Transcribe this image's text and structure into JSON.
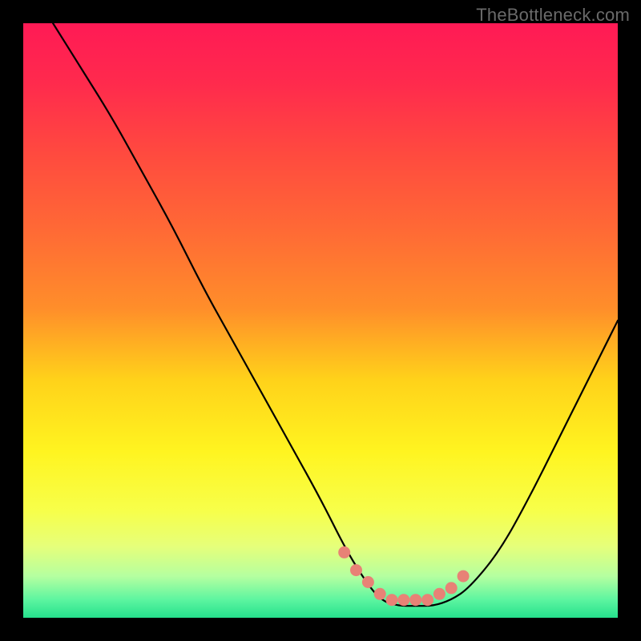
{
  "watermark": "TheBottleneck.com",
  "colors": {
    "black": "#000000",
    "line": "#000000",
    "dot": "#e88276",
    "gradient_stops": [
      {
        "offset": 0.0,
        "color": "#ff1a55"
      },
      {
        "offset": 0.1,
        "color": "#ff2a4d"
      },
      {
        "offset": 0.22,
        "color": "#ff4a3f"
      },
      {
        "offset": 0.35,
        "color": "#ff6a35"
      },
      {
        "offset": 0.48,
        "color": "#ff8e2a"
      },
      {
        "offset": 0.6,
        "color": "#ffd21a"
      },
      {
        "offset": 0.72,
        "color": "#fff420"
      },
      {
        "offset": 0.82,
        "color": "#f7ff4a"
      },
      {
        "offset": 0.88,
        "color": "#e6ff7a"
      },
      {
        "offset": 0.93,
        "color": "#b5ffa0"
      },
      {
        "offset": 0.97,
        "color": "#5cf5a0"
      },
      {
        "offset": 1.0,
        "color": "#25e08c"
      }
    ]
  },
  "chart_data": {
    "type": "line",
    "title": "",
    "xlabel": "",
    "ylabel": "",
    "xlim": [
      0,
      100
    ],
    "ylim": [
      0,
      100
    ],
    "grid": false,
    "legend": false,
    "series": [
      {
        "name": "bottleneck-curve",
        "x": [
          5,
          10,
          15,
          20,
          25,
          30,
          35,
          40,
          45,
          50,
          54,
          57,
          60,
          63,
          66,
          69,
          72,
          75,
          80,
          85,
          90,
          95,
          100
        ],
        "values": [
          100,
          92,
          84,
          75,
          66,
          56,
          47,
          38,
          29,
          20,
          12,
          7,
          3,
          2,
          2,
          2,
          3,
          5,
          11,
          20,
          30,
          40,
          50
        ]
      }
    ],
    "highlight_points": {
      "name": "optimal-range-dots",
      "x": [
        54,
        56,
        58,
        60,
        62,
        64,
        66,
        68,
        70,
        72,
        74
      ],
      "values": [
        11,
        8,
        6,
        4,
        3,
        3,
        3,
        3,
        4,
        5,
        7
      ]
    }
  }
}
